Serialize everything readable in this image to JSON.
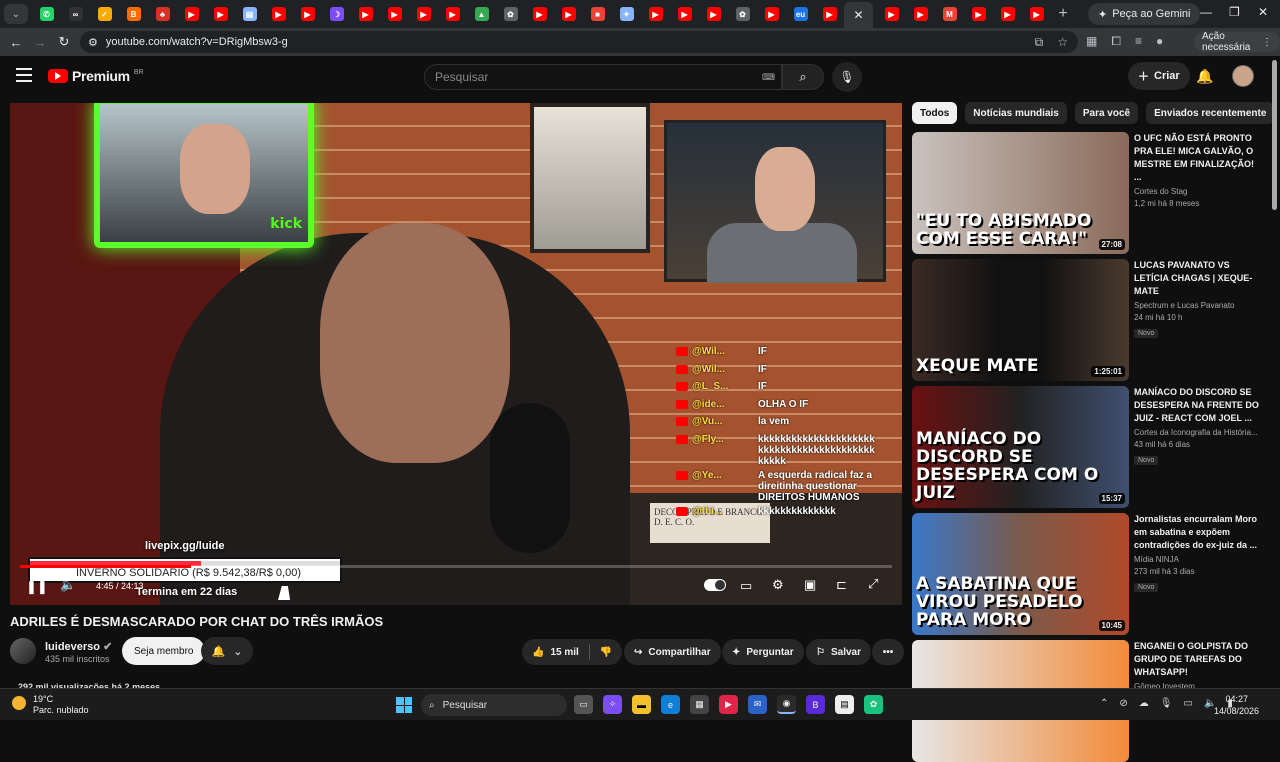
{
  "browser": {
    "tab_favicons": [
      {
        "name": "whatsapp-icon",
        "color": "#25d366",
        "glyph": "✆"
      },
      {
        "name": "infinity-icon",
        "color": "#303134",
        "glyph": "∞"
      },
      {
        "name": "checkmark-icon",
        "color": "#f9ab00",
        "glyph": "✓"
      },
      {
        "name": "blogger-icon",
        "color": "#ff6d00",
        "glyph": "B"
      },
      {
        "name": "red-icon",
        "color": "#d93025",
        "glyph": "♣"
      },
      {
        "name": "youtube-icon",
        "color": "#ff0000",
        "glyph": "▶"
      },
      {
        "name": "youtube-icon",
        "color": "#ff0000",
        "glyph": "▶"
      },
      {
        "name": "chart-icon",
        "color": "#8ab4f8",
        "glyph": "▤"
      },
      {
        "name": "youtube-icon",
        "color": "#ff0000",
        "glyph": "▶"
      },
      {
        "name": "youtube-icon",
        "color": "#ff0000",
        "glyph": "▶"
      },
      {
        "name": "moon-icon",
        "color": "#7c4dff",
        "glyph": "☽"
      },
      {
        "name": "youtube-icon",
        "color": "#ff0000",
        "glyph": "▶"
      },
      {
        "name": "youtube-icon",
        "color": "#ff0000",
        "glyph": "▶"
      },
      {
        "name": "youtube-icon",
        "color": "#ff0000",
        "glyph": "▶"
      },
      {
        "name": "youtube-icon",
        "color": "#ff0000",
        "glyph": "▶"
      },
      {
        "name": "drive-icon",
        "color": "#34a853",
        "glyph": "▲"
      },
      {
        "name": "openai-icon",
        "color": "#5f6368",
        "glyph": "✿"
      },
      {
        "name": "youtube-icon",
        "color": "#ff0000",
        "glyph": "▶"
      },
      {
        "name": "youtube-icon",
        "color": "#ff0000",
        "glyph": "▶"
      },
      {
        "name": "bag-icon",
        "color": "#ea4335",
        "glyph": "■"
      },
      {
        "name": "star-icon",
        "color": "#8ab4f8",
        "glyph": "✦"
      },
      {
        "name": "youtube-icon",
        "color": "#ff0000",
        "glyph": "▶"
      },
      {
        "name": "youtube-icon",
        "color": "#ff0000",
        "glyph": "▶"
      },
      {
        "name": "youtube-icon",
        "color": "#ff0000",
        "glyph": "▶"
      },
      {
        "name": "openai-icon",
        "color": "#5f6368",
        "glyph": "✿"
      },
      {
        "name": "youtube-icon",
        "color": "#ff0000",
        "glyph": "▶"
      },
      {
        "name": "eu-icon",
        "color": "#1a73e8",
        "glyph": "eu"
      },
      {
        "name": "youtube-icon",
        "color": "#ff0000",
        "glyph": "▶"
      }
    ],
    "tab_favicons_after": [
      {
        "name": "youtube-icon",
        "color": "#ff0000",
        "glyph": "▶"
      },
      {
        "name": "youtube-icon",
        "color": "#ff0000",
        "glyph": "▶"
      },
      {
        "name": "gmail-icon",
        "color": "#ea4335",
        "glyph": "M"
      },
      {
        "name": "youtube-icon",
        "color": "#ff0000",
        "glyph": "▶"
      },
      {
        "name": "youtube-icon",
        "color": "#ff0000",
        "glyph": "▶"
      },
      {
        "name": "youtube-icon",
        "color": "#ff0000",
        "glyph": "▶"
      }
    ],
    "gemini_label": "Peça ao Gemini",
    "url": "youtube.com/watch?v=DRigMbsw3-g",
    "action_needed": "Ação necessária"
  },
  "yt": {
    "logo_text": "Premium",
    "region": "BR",
    "search_placeholder": "Pesquisar",
    "create_label": "Criar"
  },
  "player": {
    "kick_label": "kick",
    "chat": [
      {
        "user": "@Wil...",
        "msg": "IF"
      },
      {
        "user": "@Wil...",
        "msg": "IF"
      },
      {
        "user": "@L_S...",
        "msg": "IF"
      },
      {
        "user": "@ide...",
        "msg": "OLHA O IF"
      },
      {
        "user": "@Vu...",
        "msg": "la vem"
      },
      {
        "user": "@Fly...",
        "msg": "kkkkkkkkkkkkkkkkkkkkk kkkkkkkkkkkkkkkkkkkkk kkkkk"
      },
      {
        "user": "@Ye...",
        "msg": "A esquerda radical faz a direitinha questionar DIREITOS HUMANOS"
      },
      {
        "user": "@thi...",
        "msg": "kkkkkkkkkkkkkk"
      }
    ],
    "book_text": "DECOR PRETO E BRANCO  D. E. C. O.",
    "livepix": "livepix.gg/luide",
    "donation_goal": "INVERNO SOLIDÁRIO (R$ 9.542,38/R$ 0,00)",
    "donation_progress": 0.55,
    "ends_in": "Termina em 22 dias",
    "time": "4:45 / 24:13",
    "progress": 0.196
  },
  "video": {
    "title": "ADRILES É DESMASCARADO POR CHAT DO TRÊS IRMÃOS",
    "channel": "luideverso",
    "subs": "435 mil inscritos",
    "member_label": "Seja membro",
    "likes": "15 mil",
    "share_label": "Compartilhar",
    "ask_label": "Perguntar",
    "save_label": "Salvar",
    "meta": "292 mil visualizações  há 2 meses"
  },
  "sidebar": {
    "chips": [
      "Todos",
      "Notícias mundiais",
      "Para você",
      "Enviados recentemente"
    ],
    "recs": [
      {
        "title": "O UFC NÃO ESTÁ PRONTO PRA ELE! MICA GALVÃO, O MESTRE EM FINALIZAÇÃO! ...",
        "channel": "Cortes do Stag",
        "stats": "1,2 mi  há 8 meses",
        "duration": "27:08",
        "thumb_text": "\"EU TO ABISMADO COM ESSE CARA!\"",
        "badge": "",
        "bg": "linear-gradient(90deg,#c9c2bd,#8a6a5a)"
      },
      {
        "title": "LUCAS PAVANATO VS LETÍCIA CHAGAS | XEQUE-MATE",
        "channel": "Spectrum  e Lucas Pavanato",
        "stats": "24 mi  há 10 h",
        "duration": "1:25:01",
        "thumb_text": "XEQUE MATE",
        "badge": "Novo",
        "bg": "linear-gradient(90deg,#3b2a24,#111 40%,#111 60%,#4a3a2e)"
      },
      {
        "title": "MANÍACO DO DISCORD SE DESESPERA NA FRENTE DO JUIZ - REACT COM JOEL ...",
        "channel": "Cortes da Iconografia da História...",
        "stats": "43 mil  há 6 dias",
        "duration": "15:37",
        "thumb_text": "MANÍACO DO DISCORD SE DESESPERA COM O JUIZ",
        "badge": "Novo",
        "bg": "linear-gradient(90deg,#6b1010,#222 50%,#405070)"
      },
      {
        "title": "Jornalistas encurralam Moro em sabatina e expõem contradições do ex-juiz da ...",
        "channel": "Mídia NINJA",
        "stats": "273 mil  há 3 dias",
        "duration": "10:45",
        "thumb_text": "A SABATINA QUE VIROU PESADELO PARA MORO",
        "badge": "Novo",
        "bg": "linear-gradient(90deg,#3a78c9,#7a5a4a 50%,#b14a2a)"
      },
      {
        "title": "ENGANEI O GOLPISTA DO GRUPO DE TAREFAS DO WHATSAPP!",
        "channel": "Gômeo Investem",
        "stats": "",
        "duration": "",
        "thumb_text": "",
        "badge": "",
        "bg": "linear-gradient(90deg,#e6e6e6,#f28b3a)"
      }
    ]
  },
  "taskbar": {
    "temp": "19°C",
    "weather": "Parc. nublado",
    "search": "Pesquisar",
    "time": "04:27",
    "date": "14/08/2026"
  }
}
